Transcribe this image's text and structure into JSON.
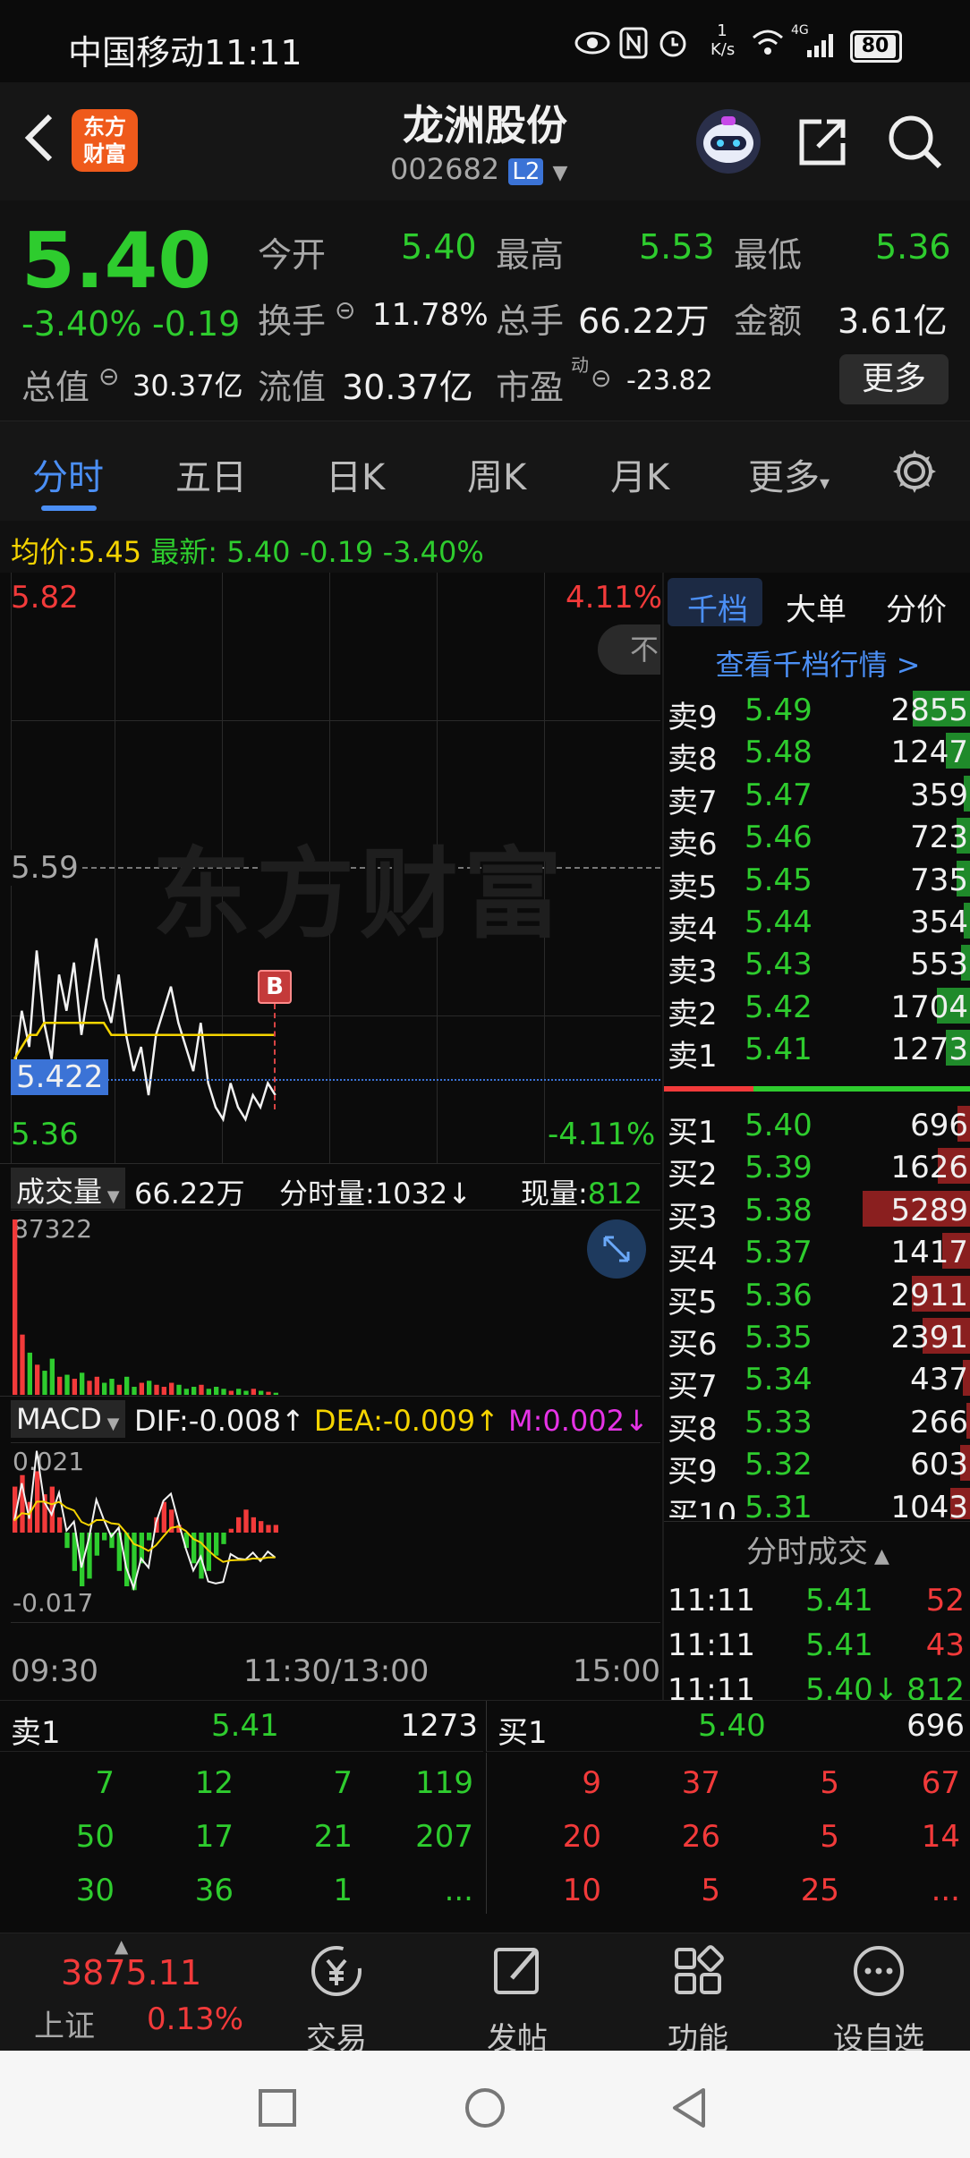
{
  "statusbar": {
    "carrier_time": "中国移动11:11",
    "speed_top": "1",
    "speed_unit": "K/s",
    "battery": "80",
    "network": "4G"
  },
  "header": {
    "back_icon": "chevron-left-icon",
    "logo_line1": "东方",
    "logo_line2": "财富",
    "stock_name": "龙洲股份",
    "stock_code": "002682",
    "level_badge": "L2"
  },
  "quote": {
    "price": "5.40",
    "change_pct": "-3.40%",
    "change": "-0.19",
    "open_label": "今开",
    "open": "5.40",
    "high_label": "最高",
    "high": "5.53",
    "low_label": "最低",
    "low": "5.36",
    "turnover_label": "换手",
    "turnover": "11.78%",
    "volume_label": "总手",
    "volume": "66.22万",
    "amount_label": "金额",
    "amount": "3.61亿",
    "mktcap_label": "总值",
    "mktcap": "30.37亿",
    "float_label": "流值",
    "float_cap": "30.37亿",
    "pe_label": "市盈",
    "pe_sup": "动",
    "pe": "-23.82",
    "more_button": "更多"
  },
  "tabs": [
    "分时",
    "五日",
    "日K",
    "周K",
    "月K",
    "更多"
  ],
  "avg_line": {
    "avg_label": "均价:",
    "avg": "5.45",
    "latest_label": "最新:",
    "latest": "5.40",
    "chg": "-0.19",
    "pct": "-3.40%"
  },
  "chart": {
    "price_top": "5.82",
    "pct_top": "4.11%",
    "price_mid": "5.59",
    "price_bottom": "5.36",
    "pct_bottom": "-4.11%",
    "crosshair_price": "5.422",
    "buy_marker": "B",
    "watermark": "东方财富",
    "side_tab": "不",
    "vol_selector": "成交量",
    "vol_total": "66.22万",
    "tick_vol_label": "分时量:",
    "tick_vol": "1032",
    "cur_vol_label": "现量:",
    "cur_vol": "812",
    "vol_max": "87322",
    "macd_selector": "MACD",
    "dif_label": "DIF:",
    "dif": "-0.008",
    "dea_label": "DEA:",
    "dea": "-0.009",
    "m_label": "M:",
    "m": "0.002",
    "macd_top": "0.021",
    "macd_bottom": "-0.017",
    "t_start": "09:30",
    "t_mid": "11:30/13:00",
    "t_end": "15:00"
  },
  "orderbook": {
    "tabs": [
      "千档",
      "大单",
      "分价"
    ],
    "link": "查看千档行情 >",
    "sells": [
      {
        "label": "卖9",
        "price": "5.49",
        "vol": "2855",
        "fill": 0.54
      },
      {
        "label": "卖8",
        "price": "5.48",
        "vol": "1247",
        "fill": 0.24
      },
      {
        "label": "卖7",
        "price": "5.47",
        "vol": "359",
        "fill": 0.07
      },
      {
        "label": "卖6",
        "price": "5.46",
        "vol": "723",
        "fill": 0.14
      },
      {
        "label": "卖5",
        "price": "5.45",
        "vol": "735",
        "fill": 0.14
      },
      {
        "label": "卖4",
        "price": "5.44",
        "vol": "354",
        "fill": 0.07
      },
      {
        "label": "卖3",
        "price": "5.43",
        "vol": "553",
        "fill": 0.1
      },
      {
        "label": "卖2",
        "price": "5.42",
        "vol": "1704",
        "fill": 0.32
      },
      {
        "label": "卖1",
        "price": "5.41",
        "vol": "1273",
        "fill": 0.24
      }
    ],
    "buys": [
      {
        "label": "买1",
        "price": "5.40",
        "vol": "696",
        "fill": 0.13
      },
      {
        "label": "买2",
        "price": "5.39",
        "vol": "1626",
        "fill": 0.31
      },
      {
        "label": "买3",
        "price": "5.38",
        "vol": "5289",
        "fill": 1.0
      },
      {
        "label": "买4",
        "price": "5.37",
        "vol": "1417",
        "fill": 0.27
      },
      {
        "label": "买5",
        "price": "5.36",
        "vol": "2911",
        "fill": 0.55
      },
      {
        "label": "买6",
        "price": "5.35",
        "vol": "2391",
        "fill": 0.45
      },
      {
        "label": "买7",
        "price": "5.34",
        "vol": "437",
        "fill": 0.08
      },
      {
        "label": "买8",
        "price": "5.33",
        "vol": "266",
        "fill": 0.05
      },
      {
        "label": "买9",
        "price": "5.32",
        "vol": "603",
        "fill": 0.11
      },
      {
        "label": "买10",
        "price": "5.31",
        "vol": "1043",
        "fill": 0.2
      }
    ],
    "trades_title": "分时成交",
    "trades": [
      {
        "time": "11:11",
        "price": "5.41",
        "vol": "52"
      },
      {
        "time": "11:11",
        "price": "5.41",
        "vol": "43"
      },
      {
        "time": "11:11",
        "price": "5.40↓",
        "vol": "812"
      }
    ]
  },
  "bottombook": {
    "sell_label": "卖1",
    "sell_price": "5.41",
    "sell_vol": "1273",
    "buy_label": "买1",
    "buy_price": "5.40",
    "buy_vol": "696",
    "sell_queue": [
      [
        "7",
        "12",
        "7",
        "119"
      ],
      [
        "50",
        "17",
        "21",
        "207"
      ],
      [
        "30",
        "36",
        "1",
        "..."
      ]
    ],
    "buy_queue": [
      [
        "9",
        "37",
        "5",
        "67"
      ],
      [
        "20",
        "26",
        "5",
        "14"
      ],
      [
        "10",
        "5",
        "25",
        "..."
      ]
    ]
  },
  "toolbar": {
    "index_value": "3875.11",
    "index_name": "上证",
    "index_pct": "0.13%",
    "items": [
      "交易",
      "发帖",
      "功能",
      "设自选"
    ]
  },
  "colors": {
    "up": "#f23a3a",
    "down": "#2ecc2e",
    "avg": "#f5d400",
    "accent": "#4b8ff5"
  },
  "chart_data": {
    "type": "line",
    "price_series": [
      5.42,
      5.47,
      5.44,
      5.52,
      5.46,
      5.43,
      5.5,
      5.47,
      5.51,
      5.45,
      5.49,
      5.53,
      5.48,
      5.46,
      5.5,
      5.45,
      5.42,
      5.44,
      5.4,
      5.45,
      5.47,
      5.49,
      5.46,
      5.44,
      5.42,
      5.46,
      5.41,
      5.39,
      5.38,
      5.41,
      5.39,
      5.38,
      5.4,
      5.39,
      5.41,
      5.4
    ],
    "avg_series": [
      5.43,
      5.44,
      5.45,
      5.45,
      5.46,
      5.46,
      5.46,
      5.46,
      5.46,
      5.46,
      5.46,
      5.46,
      5.46,
      5.45,
      5.45,
      5.45,
      5.45,
      5.45,
      5.45,
      5.45,
      5.45,
      5.45,
      5.45,
      5.45,
      5.45,
      5.45,
      5.45,
      5.45,
      5.45,
      5.45,
      5.45,
      5.45,
      5.45,
      5.45,
      5.45,
      5.45
    ],
    "ylim": [
      5.36,
      5.82
    ],
    "volume": [
      87322,
      30000,
      21000,
      15000,
      12000,
      18000,
      9000,
      10000,
      8000,
      11000,
      7000,
      9000,
      6000,
      8000,
      5000,
      9000,
      4000,
      6000,
      7000,
      5000,
      4000,
      6000,
      5000,
      3000,
      4000,
      5000,
      3000,
      4000,
      3000,
      2000,
      3000,
      2000,
      3000,
      2000,
      1500,
      1032
    ],
    "macd_hist": [
      0.012,
      0.015,
      0.008,
      0.016,
      0.01,
      0.012,
      0.004,
      -0.004,
      -0.01,
      -0.014,
      -0.012,
      -0.006,
      -0.002,
      -0.004,
      -0.01,
      -0.014,
      -0.015,
      -0.008,
      -0.002,
      0.004,
      0.008,
      0.006,
      0.002,
      -0.004,
      -0.008,
      -0.012,
      -0.01,
      -0.006,
      -0.003,
      0.001,
      0.004,
      0.006,
      0.004,
      0.003,
      0.002,
      0.002
    ]
  }
}
